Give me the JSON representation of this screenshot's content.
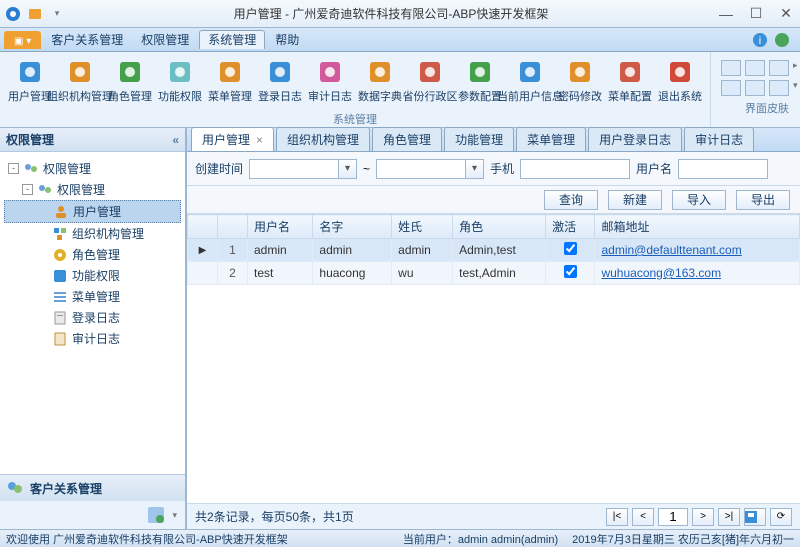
{
  "window": {
    "title": "用户管理 - 广州爱奇迪软件科技有限公司-ABP快速开发框架"
  },
  "menus": {
    "icon_tab": "☰",
    "tabs": [
      "客户关系管理",
      "权限管理",
      "系统管理",
      "帮助"
    ],
    "active_index": 2
  },
  "ribbon": {
    "groups": [
      {
        "label": "系统管理",
        "items": [
          "用户管理",
          "组织机构管理",
          "角色管理",
          "功能权限",
          "菜单管理",
          "登录日志",
          "审计日志",
          "数据字典",
          "省份行政区",
          "参数配置",
          "当前用户信息",
          "密码修改",
          "菜单配置",
          "退出系统"
        ]
      },
      {
        "label": "界面皮肤"
      }
    ]
  },
  "sidebar": {
    "title": "权限管理",
    "nodes": [
      {
        "d": 0,
        "label": "权限管理",
        "exp": "-",
        "icon": "group"
      },
      {
        "d": 1,
        "label": "权限管理",
        "exp": "-",
        "icon": "group"
      },
      {
        "d": 2,
        "label": "用户管理",
        "icon": "user",
        "selected": true
      },
      {
        "d": 2,
        "label": "组织机构管理",
        "icon": "org"
      },
      {
        "d": 2,
        "label": "角色管理",
        "icon": "role"
      },
      {
        "d": 2,
        "label": "功能权限",
        "icon": "func"
      },
      {
        "d": 2,
        "label": "菜单管理",
        "icon": "menu"
      },
      {
        "d": 2,
        "label": "登录日志",
        "icon": "log"
      },
      {
        "d": 2,
        "label": "审计日志",
        "icon": "audit"
      }
    ],
    "footer_link": "客户关系管理"
  },
  "tabs": {
    "items": [
      "用户管理",
      "组织机构管理",
      "角色管理",
      "功能管理",
      "菜单管理",
      "用户登录日志",
      "审计日志"
    ],
    "active_index": 0
  },
  "filter": {
    "l_created": "创建时间",
    "sep": "~",
    "l_phone": "手机",
    "l_username": "用户名"
  },
  "actions": {
    "query": "查询",
    "new": "新建",
    "import": "导入",
    "export": "导出"
  },
  "grid": {
    "columns": [
      "用户名",
      "名字",
      "姓氏",
      "角色",
      "激活",
      "邮箱地址"
    ],
    "rows": [
      {
        "n": "1",
        "username": "admin",
        "first": "admin",
        "last": "admin",
        "roles": "Admin,test",
        "active": true,
        "email": "admin@defaulttenant.com"
      },
      {
        "n": "2",
        "username": "test",
        "first": "huacong",
        "last": "wu",
        "roles": "test,Admin",
        "active": true,
        "email": "wuhuacong@163.com"
      }
    ]
  },
  "pager": {
    "summary": "共2条记录，每页50条，共1页",
    "page": "1"
  },
  "status": {
    "welcome": "欢迎使用 广州爱奇迪软件科技有限公司-ABP快速开发框架",
    "user": "当前用户：admin admin(admin)",
    "date": "2019年7月3日星期三 农历己亥[猪]年六月初一"
  }
}
